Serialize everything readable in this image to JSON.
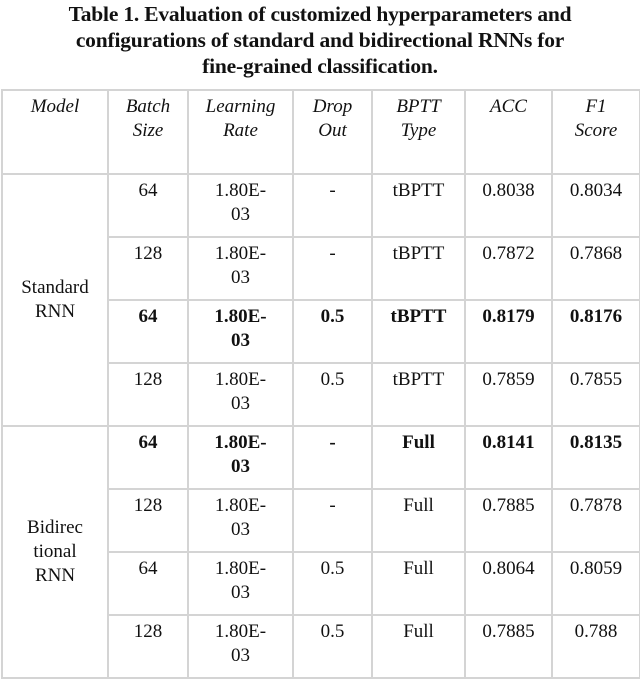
{
  "caption": {
    "line1": "Table 1. Evaluation of customized hyperparameters and",
    "line2": "configurations of standard and bidirectional RNNs for",
    "line3": "fine-grained classification."
  },
  "headers": {
    "model": "Model",
    "batch_size": [
      "Batch",
      "Size"
    ],
    "learning_rate": [
      "Learning",
      "Rate"
    ],
    "dropout": [
      "Drop",
      "Out"
    ],
    "bptt_type": [
      "BPTT",
      "Type"
    ],
    "acc": "ACC",
    "f1": [
      "F1",
      "Score"
    ]
  },
  "groups": [
    {
      "label": [
        "Standard",
        "RNN"
      ],
      "rows": [
        {
          "batch": "64",
          "lr": [
            "1.80E-",
            "03"
          ],
          "dropout": "-",
          "bptt": "tBPTT",
          "acc": "0.8038",
          "f1": "0.8034",
          "bold": false
        },
        {
          "batch": "128",
          "lr": [
            "1.80E-",
            "03"
          ],
          "dropout": "-",
          "bptt": "tBPTT",
          "acc": "0.7872",
          "f1": "0.7868",
          "bold": false
        },
        {
          "batch": "64",
          "lr": [
            "1.80E-",
            "03"
          ],
          "dropout": "0.5",
          "bptt": "tBPTT",
          "acc": "0.8179",
          "f1": "0.8176",
          "bold": true
        },
        {
          "batch": "128",
          "lr": [
            "1.80E-",
            "03"
          ],
          "dropout": "0.5",
          "bptt": "tBPTT",
          "acc": "0.7859",
          "f1": "0.7855",
          "bold": false
        }
      ]
    },
    {
      "label": [
        "Bidirec",
        "tional",
        "RNN"
      ],
      "rows": [
        {
          "batch": "64",
          "lr": [
            "1.80E-",
            "03"
          ],
          "dropout": "-",
          "bptt": "Full",
          "acc": "0.8141",
          "f1": "0.8135",
          "bold": true
        },
        {
          "batch": "128",
          "lr": [
            "1.80E-",
            "03"
          ],
          "dropout": "-",
          "bptt": "Full",
          "acc": "0.7885",
          "f1": "0.7878",
          "bold": false
        },
        {
          "batch": "64",
          "lr": [
            "1.80E-",
            "03"
          ],
          "dropout": "0.5",
          "bptt": "Full",
          "acc": "0.8064",
          "f1": "0.8059",
          "bold": false
        },
        {
          "batch": "128",
          "lr": [
            "1.80E-",
            "03"
          ],
          "dropout": "0.5",
          "bptt": "Full",
          "acc": "0.7885",
          "f1": "0.788",
          "bold": false
        }
      ]
    }
  ]
}
